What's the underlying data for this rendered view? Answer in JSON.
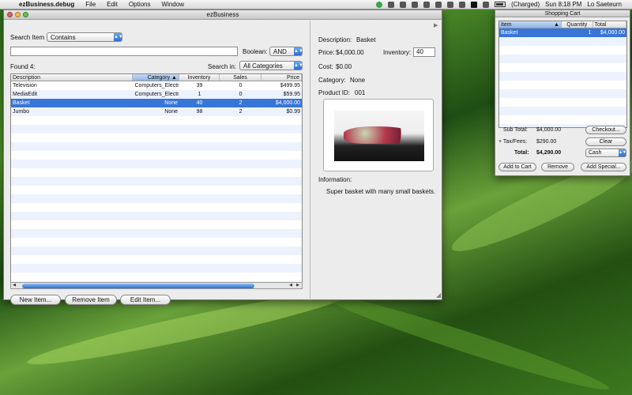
{
  "menubar": {
    "app_name": "ezBusiness.debug",
    "menus": [
      "File",
      "Edit",
      "Options",
      "Window"
    ],
    "battery_status": "(Charged)",
    "clock": "Sun 8:18 PM",
    "user": "Lo Saeteurn"
  },
  "main_window": {
    "title": "ezBusiness",
    "search_item_label": "Search Item",
    "search_mode": "Contains",
    "search_value": "",
    "boolean_label": "Boolean:",
    "boolean_value": "AND",
    "found_label": "Found 4:",
    "search_in_label": "Search in:",
    "search_in_value": "All Categories",
    "columns": [
      "Description",
      "Category",
      "Inventory",
      "Sales",
      "Price"
    ],
    "rows": [
      {
        "description": "Television",
        "category": "Computers_Electr...",
        "inventory": "39",
        "sales": "0",
        "price": "$499.95"
      },
      {
        "description": "MediaEdit",
        "category": "Computers_Electr...",
        "inventory": "1",
        "sales": "0",
        "price": "$59.95"
      },
      {
        "description": "Basket",
        "category": "None",
        "inventory": "40",
        "sales": "2",
        "price": "$4,000.00"
      },
      {
        "description": "Jumbo",
        "category": "None",
        "inventory": "98",
        "sales": "2",
        "price": "$0.99"
      }
    ],
    "buttons": {
      "new": "New Item...",
      "remove": "Remove Item",
      "edit": "Edit Item..."
    }
  },
  "detail": {
    "description_label": "Description:",
    "description_value": "Basket",
    "price_label": "Price:",
    "price_value": "$4,000.00",
    "inventory_label": "Inventory:",
    "inventory_value": "40",
    "cost_label": "Cost:",
    "cost_value": "$0.00",
    "category_label": "Category:",
    "category_value": "None",
    "product_id_label": "Product ID:",
    "product_id_value": "001",
    "information_label": "Information:",
    "information_value": "Super basket with many small baskets."
  },
  "cart": {
    "title": "Shopping Cart",
    "columns": [
      "Item",
      "Quantity",
      "Total"
    ],
    "rows": [
      {
        "item": "Basket",
        "quantity": "1",
        "total": "$4,000.00"
      }
    ],
    "subtotal_label": "Sub Total:",
    "subtotal_value": "$4,000.00",
    "tax_label": "+ Tax/Fees:",
    "tax_value": "$290.00",
    "total_label": "Total:",
    "total_value": "$4,290.00",
    "payment_value": "Cash",
    "buttons": {
      "checkout": "Checkout...",
      "clear": "Clear",
      "add": "Add to Cart",
      "remove": "Remove",
      "special": "Add Special..."
    }
  },
  "colors": {
    "selection": "#3875d7",
    "stripe": "#edf3fe",
    "accent": "#2f6fd4"
  }
}
